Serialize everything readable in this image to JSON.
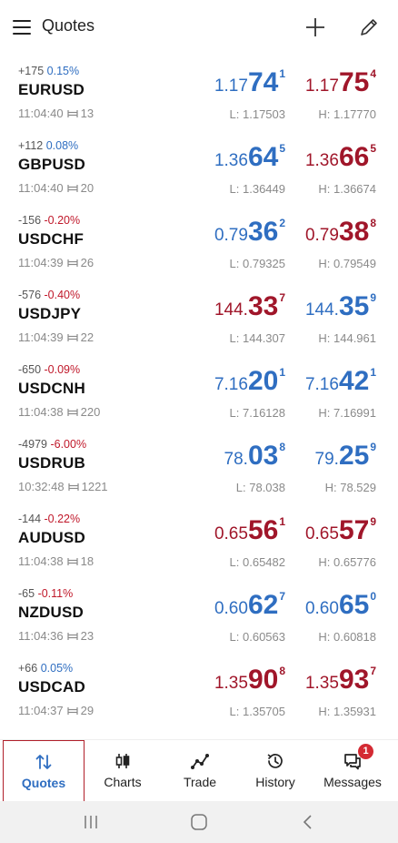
{
  "header": {
    "title": "Quotes",
    "menu_icon": "hamburger-menu-icon",
    "add_icon": "plus-icon",
    "edit_icon": "pencil-icon"
  },
  "colors": {
    "up": "#2f6ec1",
    "down": "#a0162a",
    "active_tab": "#2f6ec1",
    "badge": "#d42a33"
  },
  "quotes": [
    {
      "change_points": "+175",
      "change_pct": "0.15%",
      "dir": "up",
      "symbol": "EURUSD",
      "time": "11:04:40",
      "spread": "13",
      "bid": {
        "pre": "1.17",
        "big": "74",
        "sup": "1",
        "color": "blue"
      },
      "ask": {
        "pre": "1.17",
        "big": "75",
        "sup": "4",
        "color": "red"
      },
      "low": "L: 1.17503",
      "high": "H: 1.17770"
    },
    {
      "change_points": "+112",
      "change_pct": "0.08%",
      "dir": "up",
      "symbol": "GBPUSD",
      "time": "11:04:40",
      "spread": "20",
      "bid": {
        "pre": "1.36",
        "big": "64",
        "sup": "5",
        "color": "blue"
      },
      "ask": {
        "pre": "1.36",
        "big": "66",
        "sup": "5",
        "color": "red"
      },
      "low": "L: 1.36449",
      "high": "H: 1.36674"
    },
    {
      "change_points": "-156",
      "change_pct": "-0.20%",
      "dir": "down",
      "symbol": "USDCHF",
      "time": "11:04:39",
      "spread": "26",
      "bid": {
        "pre": "0.79",
        "big": "36",
        "sup": "2",
        "color": "blue"
      },
      "ask": {
        "pre": "0.79",
        "big": "38",
        "sup": "8",
        "color": "red"
      },
      "low": "L: 0.79325",
      "high": "H: 0.79549"
    },
    {
      "change_points": "-576",
      "change_pct": "-0.40%",
      "dir": "down",
      "symbol": "USDJPY",
      "time": "11:04:39",
      "spread": "22",
      "bid": {
        "pre": "144.",
        "big": "33",
        "sup": "7",
        "color": "red"
      },
      "ask": {
        "pre": "144.",
        "big": "35",
        "sup": "9",
        "color": "blue"
      },
      "low": "L: 144.307",
      "high": "H: 144.961"
    },
    {
      "change_points": "-650",
      "change_pct": "-0.09%",
      "dir": "down",
      "symbol": "USDCNH",
      "time": "11:04:38",
      "spread": "220",
      "bid": {
        "pre": "7.16",
        "big": "20",
        "sup": "1",
        "color": "blue"
      },
      "ask": {
        "pre": "7.16",
        "big": "42",
        "sup": "1",
        "color": "blue"
      },
      "low": "L: 7.16128",
      "high": "H: 7.16991"
    },
    {
      "change_points": "-4979",
      "change_pct": "-6.00%",
      "dir": "down",
      "symbol": "USDRUB",
      "time": "10:32:48",
      "spread": "1221",
      "bid": {
        "pre": "78.",
        "big": "03",
        "sup": "8",
        "color": "blue"
      },
      "ask": {
        "pre": "79.",
        "big": "25",
        "sup": "9",
        "color": "blue"
      },
      "low": "L: 78.038",
      "high": "H: 78.529"
    },
    {
      "change_points": "-144",
      "change_pct": "-0.22%",
      "dir": "down",
      "symbol": "AUDUSD",
      "time": "11:04:38",
      "spread": "18",
      "bid": {
        "pre": "0.65",
        "big": "56",
        "sup": "1",
        "color": "red"
      },
      "ask": {
        "pre": "0.65",
        "big": "57",
        "sup": "9",
        "color": "red"
      },
      "low": "L: 0.65482",
      "high": "H: 0.65776"
    },
    {
      "change_points": "-65",
      "change_pct": "-0.11%",
      "dir": "down",
      "symbol": "NZDUSD",
      "time": "11:04:36",
      "spread": "23",
      "bid": {
        "pre": "0.60",
        "big": "62",
        "sup": "7",
        "color": "blue"
      },
      "ask": {
        "pre": "0.60",
        "big": "65",
        "sup": "0",
        "color": "blue"
      },
      "low": "L: 0.60563",
      "high": "H: 0.60818"
    },
    {
      "change_points": "+66",
      "change_pct": "0.05%",
      "dir": "up",
      "symbol": "USDCAD",
      "time": "11:04:37",
      "spread": "29",
      "bid": {
        "pre": "1.35",
        "big": "90",
        "sup": "8",
        "color": "red"
      },
      "ask": {
        "pre": "1.35",
        "big": "93",
        "sup": "7",
        "color": "red"
      },
      "low": "L: 1.35705",
      "high": "H: 1.35931"
    }
  ],
  "bottom_nav": [
    {
      "label": "Quotes",
      "icon": "arrows-up-down-icon",
      "active": true
    },
    {
      "label": "Charts",
      "icon": "candlestick-icon",
      "active": false
    },
    {
      "label": "Trade",
      "icon": "trend-line-icon",
      "active": false
    },
    {
      "label": "History",
      "icon": "history-clock-icon",
      "active": false
    },
    {
      "label": "Messages",
      "icon": "chat-bubbles-icon",
      "active": false,
      "badge": "1"
    }
  ],
  "system_nav": {
    "recents_icon": "recents-icon",
    "home_icon": "home-icon",
    "back_icon": "back-icon"
  }
}
